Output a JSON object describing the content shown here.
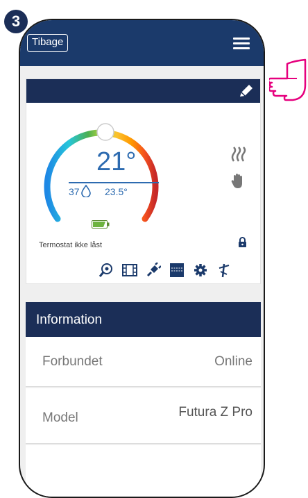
{
  "step_number": "3",
  "header": {
    "back_label": "Tibage"
  },
  "thermostat": {
    "temperature": "21°",
    "humidity": "37",
    "setpoint": "23.5°",
    "lock_status": "Termostat ikke låst",
    "dial_colors": [
      "#1e88e5",
      "#26c6da",
      "#4caf50",
      "#cddc39",
      "#fbc02d",
      "#ff9800",
      "#f4511e",
      "#c62828"
    ],
    "battery_color": "#6db33f"
  },
  "icons": [
    "zoom-icon",
    "film-icon",
    "plug-icon",
    "schedule-icon",
    "gear-icon",
    "antenna-icon"
  ],
  "information": {
    "title": "Information",
    "rows": [
      {
        "label": "Forbundet",
        "value": "Online"
      },
      {
        "label": "Model",
        "value": "Futura Z Pro"
      }
    ]
  },
  "colors": {
    "navy": "#1b2e57",
    "header": "#1b3a6b",
    "accent": "#2d6bb0",
    "pointer": "#e6007e"
  }
}
